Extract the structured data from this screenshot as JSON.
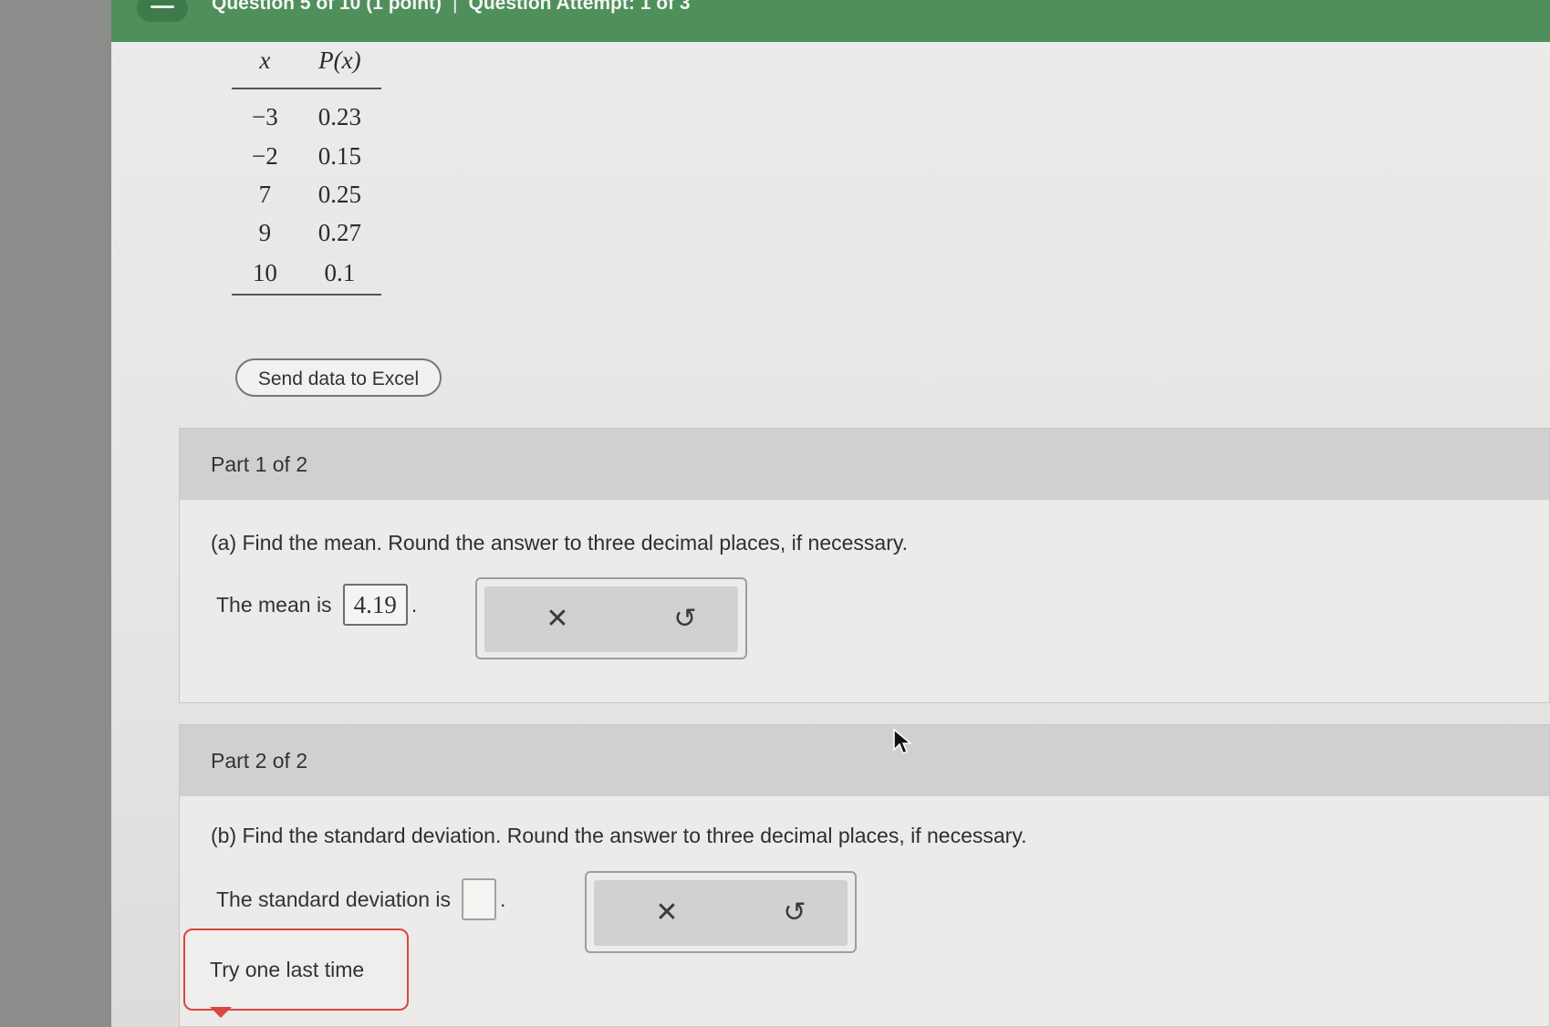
{
  "header": {
    "question_progress": "Question 5 of 10 (1 point)",
    "separator": "|",
    "attempt": "Question Attempt: 1 of 3"
  },
  "table": {
    "headers": [
      "x",
      "P(x)"
    ],
    "rows": [
      [
        "−3",
        "0.23"
      ],
      [
        "−2",
        "0.15"
      ],
      [
        "7",
        "0.25"
      ],
      [
        "9",
        "0.27"
      ],
      [
        "10",
        "0.1"
      ]
    ]
  },
  "excel_button": "Send data to Excel",
  "part1": {
    "header": "Part 1 of 2",
    "question": "(a) Find the mean. Round the answer to three decimal places, if necessary.",
    "answer_label": "The mean is",
    "answer_value": "4.19",
    "period": ".",
    "clear_icon": "✕",
    "undo_icon": "↺"
  },
  "part2": {
    "header": "Part 2 of 2",
    "question": "(b) Find the standard deviation. Round the answer to three decimal places, if necessary.",
    "answer_label": "The standard deviation is",
    "answer_value": "",
    "period": ".",
    "clear_icon": "✕",
    "undo_icon": "↺"
  },
  "callout": "Try one last time",
  "colors": {
    "header_green": "#4f8f5c",
    "callout_red": "#d9463f"
  }
}
